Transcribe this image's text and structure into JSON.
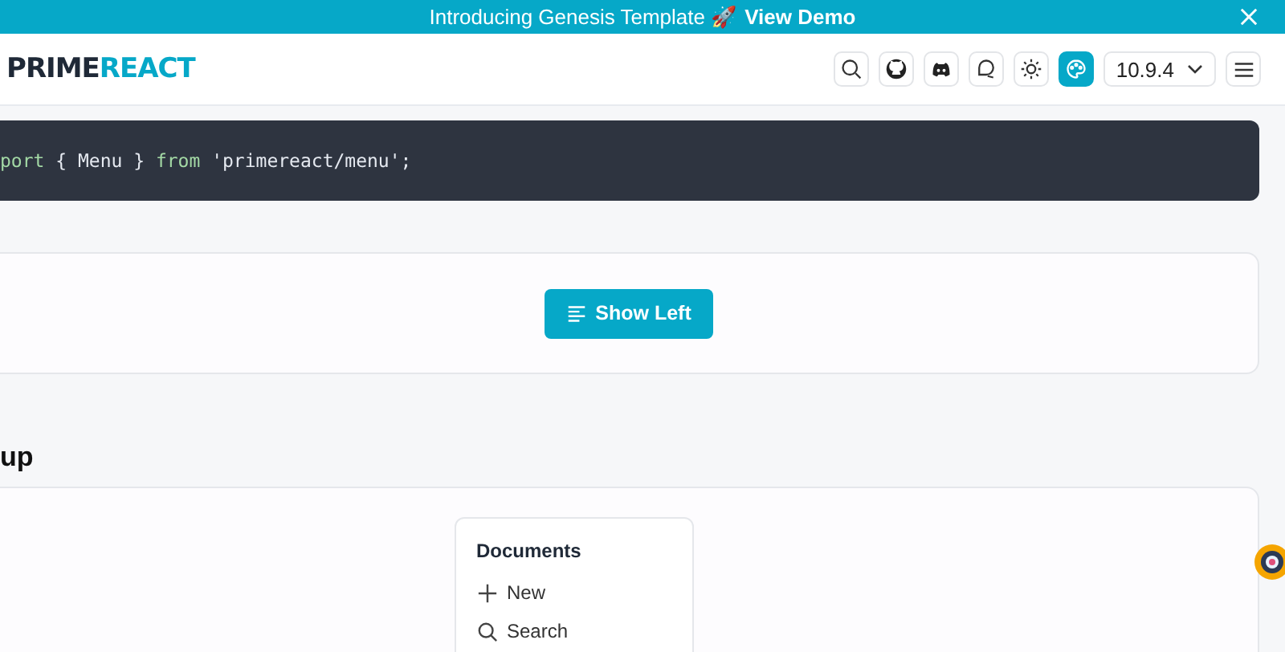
{
  "banner": {
    "text": "Introducing Genesis Template 🚀",
    "link": "View Demo"
  },
  "header": {
    "logo_dark": "PRIME",
    "logo_light": "REACT",
    "tools": [
      {
        "kind": "search",
        "selected": false
      },
      {
        "kind": "github",
        "selected": false
      },
      {
        "kind": "discord",
        "selected": false
      },
      {
        "kind": "chat",
        "selected": false
      },
      {
        "kind": "sun",
        "selected": false
      },
      {
        "kind": "palette",
        "selected": true
      }
    ],
    "version": "10.9.4"
  },
  "code": [
    {
      "kind": "keyword",
      "text": "port"
    },
    {
      "kind": "plain",
      "text": " { Menu } "
    },
    {
      "kind": "keyword",
      "text": "from"
    },
    {
      "kind": "plain",
      "text": " 'primereact/menu';"
    }
  ],
  "show_button": "Show Left",
  "section_heading": "up",
  "menu": {
    "title": "Documents",
    "items": [
      {
        "kind": "plus",
        "label": "New"
      },
      {
        "kind": "search",
        "label": "Search"
      }
    ]
  }
}
